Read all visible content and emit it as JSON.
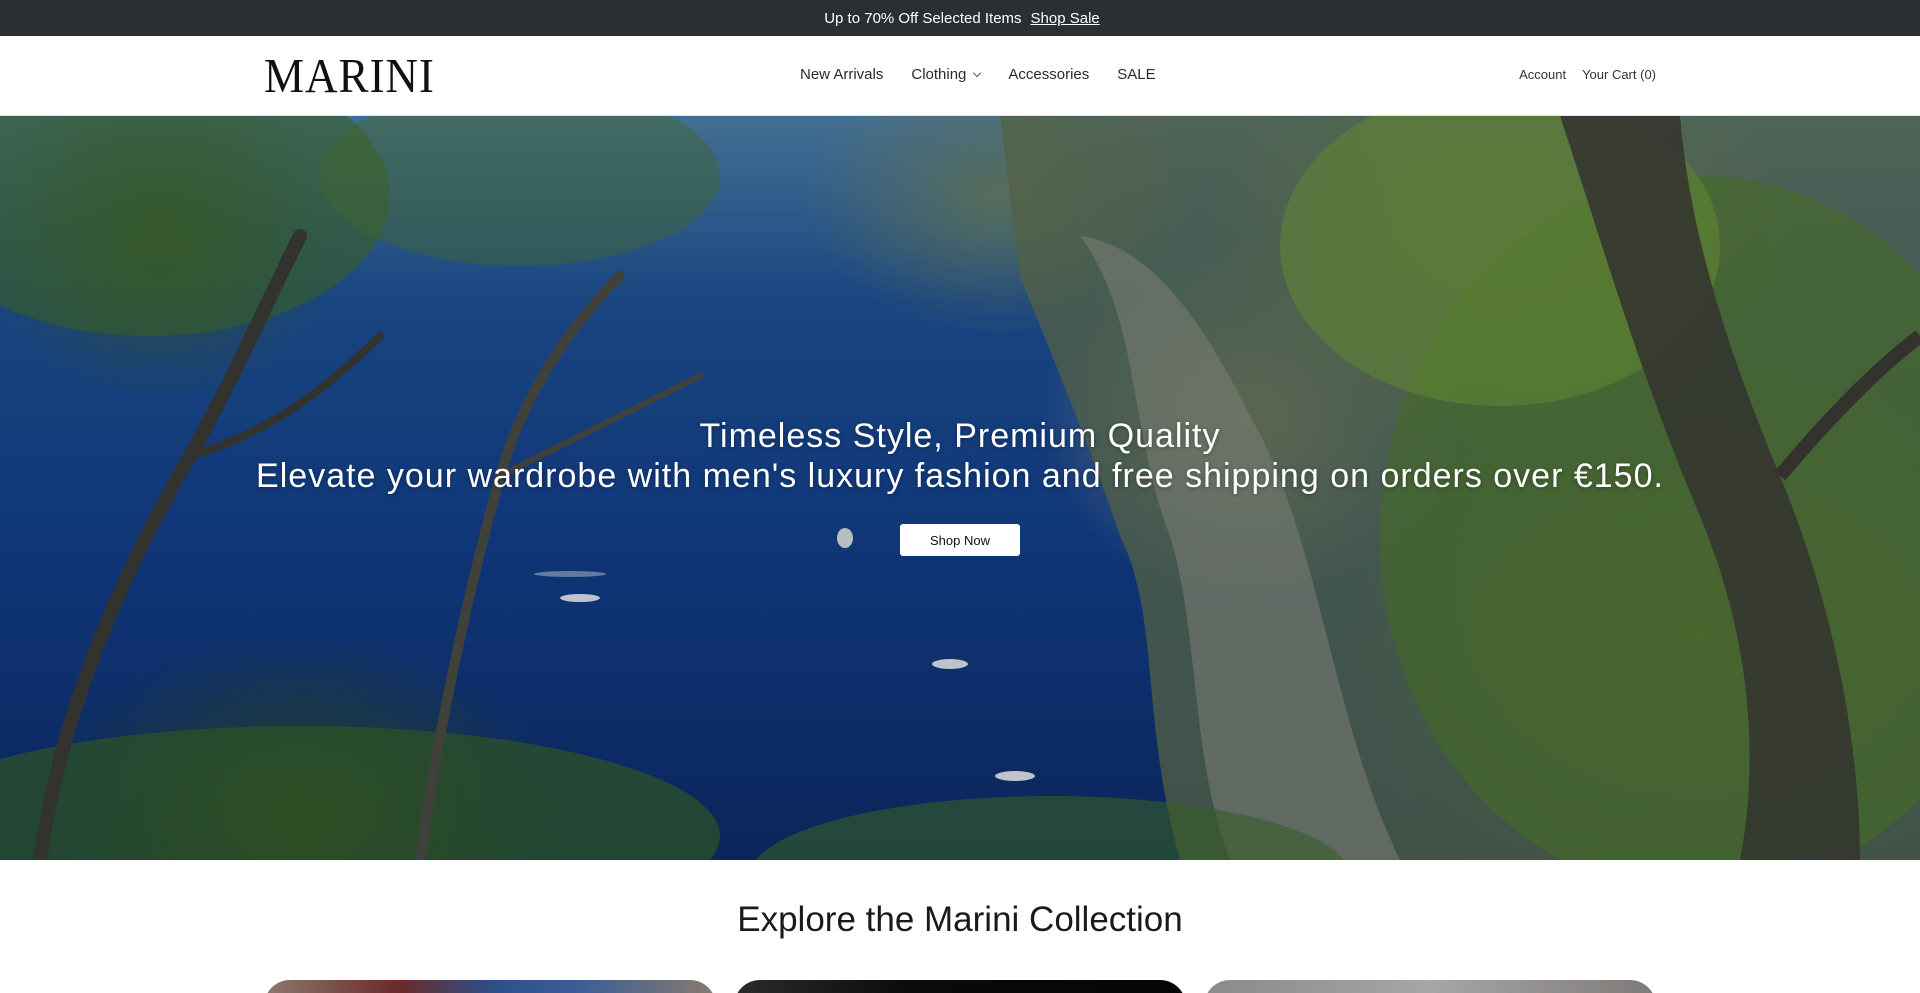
{
  "announcement": {
    "gift_glyph": "",
    "text": "Up to 70% Off Selected Items",
    "link_label": "Shop Sale",
    "close_glyph": ""
  },
  "header": {
    "logo": "MARINI",
    "nav": [
      {
        "label": "New Arrivals"
      },
      {
        "label": "Clothing",
        "has_dropdown": true
      },
      {
        "label": "Accessories"
      },
      {
        "label": "SALE"
      }
    ],
    "account_label": "Account",
    "cart_label": "Your Cart (0)"
  },
  "hero": {
    "title": "Timeless Style, Premium Quality",
    "subtitle": "Elevate your wardrobe with men's luxury fashion and free shipping on orders over €150.",
    "cta_label": "Shop Now"
  },
  "collection": {
    "title": "Explore the Marini Collection"
  },
  "colors": {
    "announcement_bg": "#2b2f31",
    "text_dark": "#1a1a1a",
    "button_bg": "#ffffff"
  }
}
